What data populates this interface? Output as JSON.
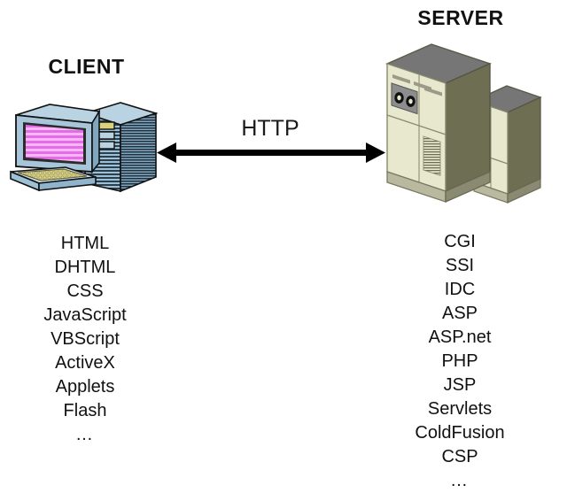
{
  "diagram": {
    "title_client": "CLIENT",
    "title_server": "SERVER",
    "protocol_label": "HTTP",
    "arrow": {
      "name": "bidirectional-arrow",
      "direction": "both"
    },
    "client": {
      "icon_name": "desktop-computer-icon",
      "technologies": [
        "HTML",
        "DHTML",
        "CSS",
        "JavaScript",
        "VBScript",
        "ActiveX",
        "Applets",
        "Flash"
      ],
      "more_indicator": "…"
    },
    "server": {
      "icon_name": "server-cabinet-icon",
      "technologies": [
        "CGI",
        "SSI",
        "IDC",
        "ASP",
        "ASP.net",
        "PHP",
        "JSP",
        "Servlets",
        "ColdFusion",
        "CSP"
      ],
      "more_indicator": "…"
    }
  },
  "colors": {
    "text": "#111111",
    "arrow": "#000000",
    "client_case": "#8fb4cc",
    "client_case_light": "#b9d3e3",
    "client_screen": "#e05ae0",
    "client_keys": "#cfc87a",
    "server_body": "#e8e8cf",
    "server_shadow": "#6e6e52",
    "server_top": "#767676",
    "background": "#ffffff"
  }
}
